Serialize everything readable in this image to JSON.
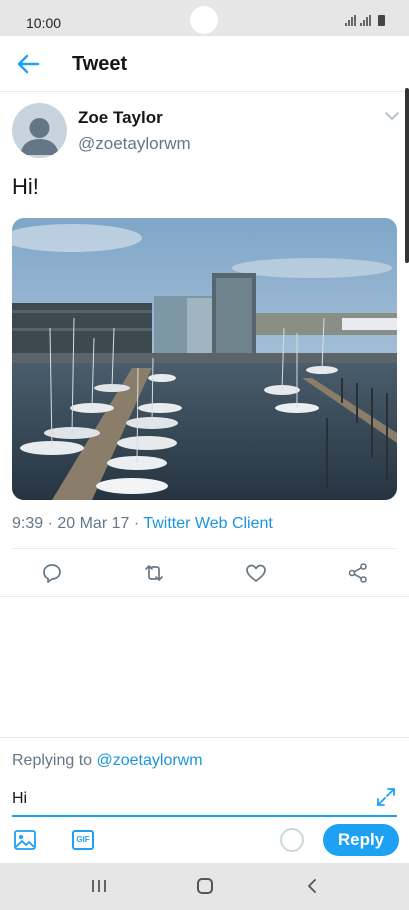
{
  "status_bar": {
    "time": "10:00"
  },
  "header": {
    "title": "Tweet",
    "back_icon": "arrow-left-icon"
  },
  "tweet": {
    "name": "Zoe Taylor",
    "handle": "@zoetaylorwm",
    "text": "Hi!",
    "time": "9:39 · 20 Mar 17 · ",
    "source": "Twitter Web Client",
    "photo": "marina-with-sailboats"
  },
  "actions": {
    "reply_icon": "comment-icon",
    "retweet_icon": "retweet-icon",
    "like_icon": "heart-icon",
    "share_icon": "share-icon"
  },
  "composer": {
    "replying_prefix": "Replying to ",
    "replying_handle": "@zoetaylorwm",
    "input_value": "Hi",
    "gif_label": "GIF",
    "reply_button": "Reply"
  },
  "colors": {
    "accent": "#1da1f2",
    "link": "#1b95e0",
    "muted": "#657786",
    "system_bar": "#e6e6e6"
  }
}
